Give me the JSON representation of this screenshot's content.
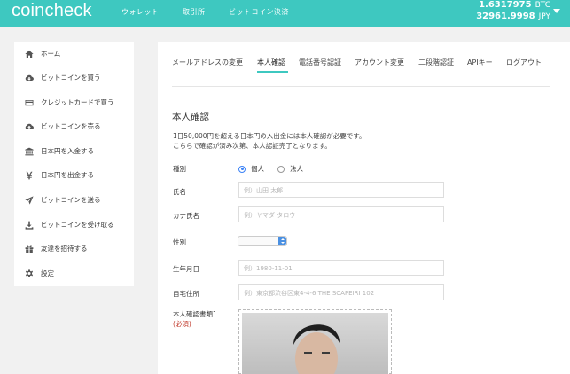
{
  "header": {
    "logo": "coincheck",
    "nav": [
      "ウォレット",
      "取引所",
      "ビットコイン決済"
    ],
    "balances": [
      {
        "amount": "1.6317975",
        "unit": "BTC"
      },
      {
        "amount": "32961.9998",
        "unit": "JPY"
      }
    ],
    "account_menu_icon": "chevron-down-icon"
  },
  "sidebar": {
    "items": [
      {
        "label": "ホーム",
        "icon": "home-icon"
      },
      {
        "label": "ビットコインを買う",
        "icon": "cloud-download-icon"
      },
      {
        "label": "クレジットカードで買う",
        "icon": "credit-card-icon"
      },
      {
        "label": "ビットコインを売る",
        "icon": "cloud-upload-icon"
      },
      {
        "label": "日本円を入金する",
        "icon": "bank-icon"
      },
      {
        "label": "日本円を出金する",
        "icon": "yen-icon"
      },
      {
        "label": "ビットコインを送る",
        "icon": "send-icon"
      },
      {
        "label": "ビットコインを受け取る",
        "icon": "download-icon"
      },
      {
        "label": "友達を招待する",
        "icon": "gift-icon"
      },
      {
        "label": "設定",
        "icon": "gear-icon"
      }
    ]
  },
  "tabs": [
    {
      "label": "メールアドレスの変更",
      "active": false
    },
    {
      "label": "本人確認",
      "active": true
    },
    {
      "label": "電話番号認証",
      "active": false
    },
    {
      "label": "アカウント変更",
      "active": false
    },
    {
      "label": "二段階認証",
      "active": false
    },
    {
      "label": "APIキー",
      "active": false
    },
    {
      "label": "ログアウト",
      "active": false
    }
  ],
  "accent_color": "#3ec8c0",
  "form": {
    "title": "本人確認",
    "description_line1": "1日50,000円を超える日本円の入出金には本人確認が必要です。",
    "description_line2": "こちらで確認が済み次第、本人認証完了となります。",
    "type_label": "種別",
    "type_options": [
      {
        "label": "個人",
        "selected": true
      },
      {
        "label": "法人",
        "selected": false
      }
    ],
    "name_label": "氏名",
    "name_placeholder": "例）山田 太郎",
    "kana_label": "カナ氏名",
    "kana_placeholder": "例）ヤマダ タロウ",
    "gender_label": "性別",
    "gender_value": "",
    "birth_label": "生年月日",
    "birth_placeholder": "例）1980-11-01",
    "address_label": "自宅住所",
    "address_placeholder": "例）東京都渋谷区東4-4-6 THE SCAPEIRI 102",
    "doc_label": "本人確認書類1",
    "doc_required": "(必須)"
  }
}
